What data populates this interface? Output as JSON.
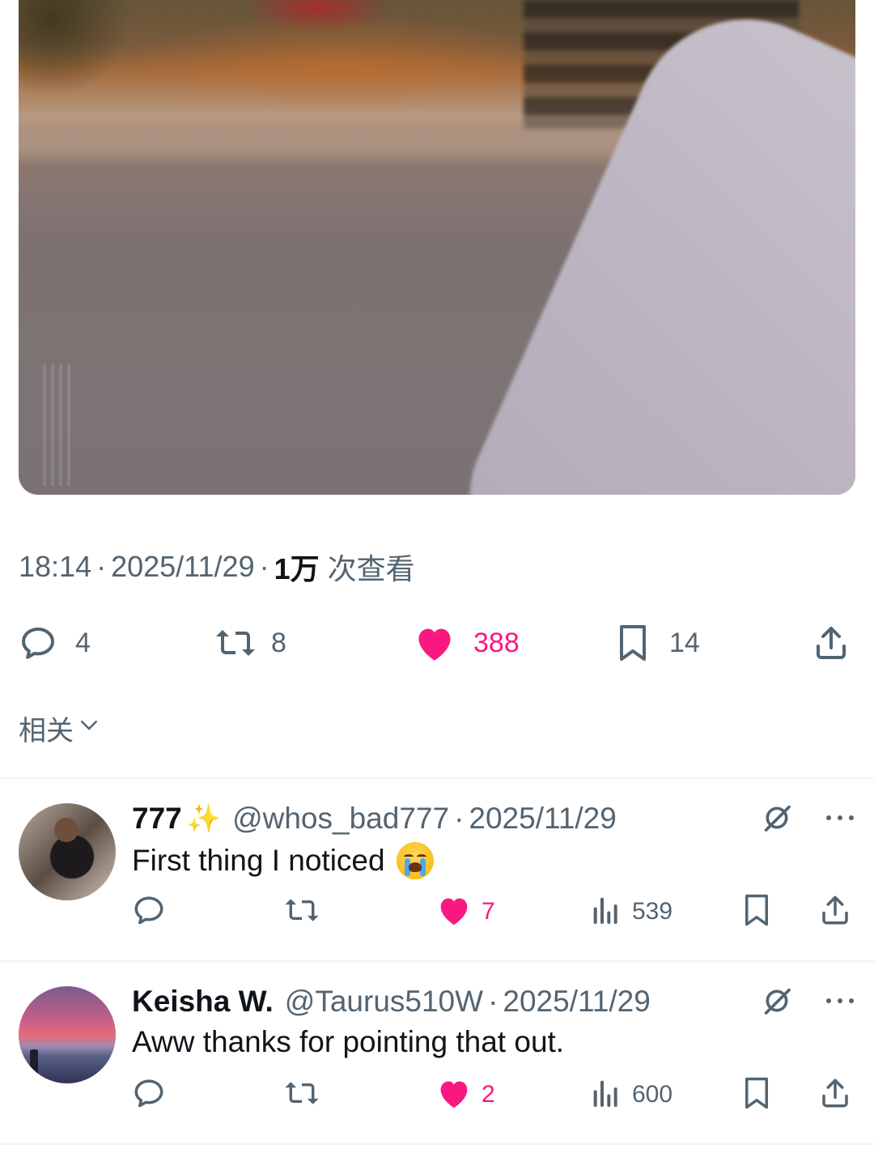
{
  "tweet": {
    "time": "18:14",
    "date": "2025/11/29",
    "views_count": "1万",
    "views_label": "次查看",
    "actions": {
      "replies": "4",
      "reposts": "8",
      "likes": "388",
      "bookmarks": "14"
    },
    "like_color": "#f91880"
  },
  "related": {
    "label": "相关"
  },
  "replies": [
    {
      "name": "777",
      "sparkle": "✨",
      "handle": "@whos_bad777",
      "date": "2025/11/29",
      "text": "First thing I noticed",
      "likes": "7",
      "views": "539",
      "liked": true
    },
    {
      "name": "Keisha W.",
      "handle": "@Taurus510W",
      "date": "2025/11/29",
      "text": "Aww thanks for pointing that out.",
      "likes": "2",
      "views": "600",
      "liked": true
    }
  ]
}
